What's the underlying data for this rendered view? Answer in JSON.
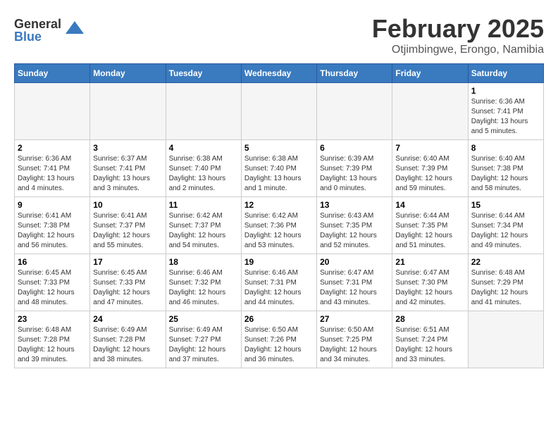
{
  "logo": {
    "general": "General",
    "blue": "Blue"
  },
  "title": {
    "month": "February 2025",
    "location": "Otjimbingwe, Erongo, Namibia"
  },
  "weekdays": [
    "Sunday",
    "Monday",
    "Tuesday",
    "Wednesday",
    "Thursday",
    "Friday",
    "Saturday"
  ],
  "weeks": [
    [
      {
        "day": "",
        "info": ""
      },
      {
        "day": "",
        "info": ""
      },
      {
        "day": "",
        "info": ""
      },
      {
        "day": "",
        "info": ""
      },
      {
        "day": "",
        "info": ""
      },
      {
        "day": "",
        "info": ""
      },
      {
        "day": "1",
        "info": "Sunrise: 6:36 AM\nSunset: 7:41 PM\nDaylight: 13 hours and 5 minutes."
      }
    ],
    [
      {
        "day": "2",
        "info": "Sunrise: 6:36 AM\nSunset: 7:41 PM\nDaylight: 13 hours and 4 minutes."
      },
      {
        "day": "3",
        "info": "Sunrise: 6:37 AM\nSunset: 7:41 PM\nDaylight: 13 hours and 3 minutes."
      },
      {
        "day": "4",
        "info": "Sunrise: 6:38 AM\nSunset: 7:40 PM\nDaylight: 13 hours and 2 minutes."
      },
      {
        "day": "5",
        "info": "Sunrise: 6:38 AM\nSunset: 7:40 PM\nDaylight: 13 hours and 1 minute."
      },
      {
        "day": "6",
        "info": "Sunrise: 6:39 AM\nSunset: 7:39 PM\nDaylight: 13 hours and 0 minutes."
      },
      {
        "day": "7",
        "info": "Sunrise: 6:40 AM\nSunset: 7:39 PM\nDaylight: 12 hours and 59 minutes."
      },
      {
        "day": "8",
        "info": "Sunrise: 6:40 AM\nSunset: 7:38 PM\nDaylight: 12 hours and 58 minutes."
      }
    ],
    [
      {
        "day": "9",
        "info": "Sunrise: 6:41 AM\nSunset: 7:38 PM\nDaylight: 12 hours and 56 minutes."
      },
      {
        "day": "10",
        "info": "Sunrise: 6:41 AM\nSunset: 7:37 PM\nDaylight: 12 hours and 55 minutes."
      },
      {
        "day": "11",
        "info": "Sunrise: 6:42 AM\nSunset: 7:37 PM\nDaylight: 12 hours and 54 minutes."
      },
      {
        "day": "12",
        "info": "Sunrise: 6:42 AM\nSunset: 7:36 PM\nDaylight: 12 hours and 53 minutes."
      },
      {
        "day": "13",
        "info": "Sunrise: 6:43 AM\nSunset: 7:35 PM\nDaylight: 12 hours and 52 minutes."
      },
      {
        "day": "14",
        "info": "Sunrise: 6:44 AM\nSunset: 7:35 PM\nDaylight: 12 hours and 51 minutes."
      },
      {
        "day": "15",
        "info": "Sunrise: 6:44 AM\nSunset: 7:34 PM\nDaylight: 12 hours and 49 minutes."
      }
    ],
    [
      {
        "day": "16",
        "info": "Sunrise: 6:45 AM\nSunset: 7:33 PM\nDaylight: 12 hours and 48 minutes."
      },
      {
        "day": "17",
        "info": "Sunrise: 6:45 AM\nSunset: 7:33 PM\nDaylight: 12 hours and 47 minutes."
      },
      {
        "day": "18",
        "info": "Sunrise: 6:46 AM\nSunset: 7:32 PM\nDaylight: 12 hours and 46 minutes."
      },
      {
        "day": "19",
        "info": "Sunrise: 6:46 AM\nSunset: 7:31 PM\nDaylight: 12 hours and 44 minutes."
      },
      {
        "day": "20",
        "info": "Sunrise: 6:47 AM\nSunset: 7:31 PM\nDaylight: 12 hours and 43 minutes."
      },
      {
        "day": "21",
        "info": "Sunrise: 6:47 AM\nSunset: 7:30 PM\nDaylight: 12 hours and 42 minutes."
      },
      {
        "day": "22",
        "info": "Sunrise: 6:48 AM\nSunset: 7:29 PM\nDaylight: 12 hours and 41 minutes."
      }
    ],
    [
      {
        "day": "23",
        "info": "Sunrise: 6:48 AM\nSunset: 7:28 PM\nDaylight: 12 hours and 39 minutes."
      },
      {
        "day": "24",
        "info": "Sunrise: 6:49 AM\nSunset: 7:28 PM\nDaylight: 12 hours and 38 minutes."
      },
      {
        "day": "25",
        "info": "Sunrise: 6:49 AM\nSunset: 7:27 PM\nDaylight: 12 hours and 37 minutes."
      },
      {
        "day": "26",
        "info": "Sunrise: 6:50 AM\nSunset: 7:26 PM\nDaylight: 12 hours and 36 minutes."
      },
      {
        "day": "27",
        "info": "Sunrise: 6:50 AM\nSunset: 7:25 PM\nDaylight: 12 hours and 34 minutes."
      },
      {
        "day": "28",
        "info": "Sunrise: 6:51 AM\nSunset: 7:24 PM\nDaylight: 12 hours and 33 minutes."
      },
      {
        "day": "",
        "info": ""
      }
    ]
  ]
}
